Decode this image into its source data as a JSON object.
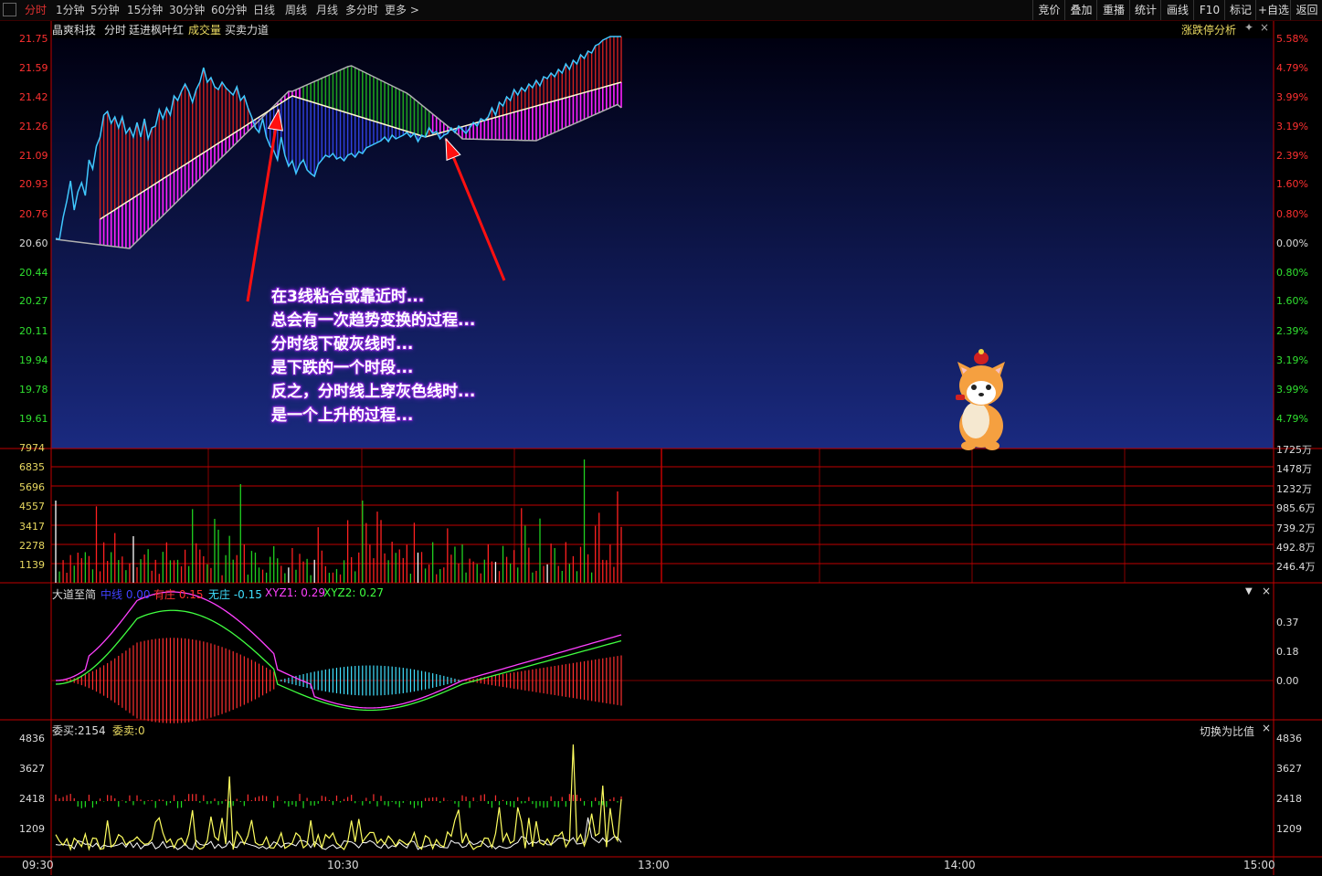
{
  "toolbar": {
    "periods": [
      "分时",
      "1分钟",
      "5分钟",
      "15分钟",
      "30分钟",
      "60分钟",
      "日线",
      "周线",
      "月线",
      "多分时",
      "更多 >"
    ],
    "active_period": "分时",
    "right_buttons": [
      "竞价",
      "叠加",
      "重播",
      "统计",
      "画线",
      "F10",
      "标记",
      "+自选",
      "返回"
    ]
  },
  "main_header": {
    "stock_name": "晶爽科技",
    "view": "分时",
    "indicator": "廷进枫叶红",
    "vol_label": "成交量",
    "force_label": "买卖力道",
    "right_label": "涨跌停分析"
  },
  "price_axis": {
    "left": [
      "21.75",
      "21.59",
      "21.42",
      "21.26",
      "21.09",
      "20.93",
      "20.76",
      "20.60",
      "20.44",
      "20.27",
      "20.11",
      "19.94",
      "19.78",
      "19.61"
    ],
    "right": [
      "5.58%",
      "4.79%",
      "3.99%",
      "3.19%",
      "2.39%",
      "1.60%",
      "0.80%",
      "0.00%",
      "0.80%",
      "1.60%",
      "2.39%",
      "3.19%",
      "3.99%",
      "4.79%"
    ]
  },
  "volume_axis": {
    "left": [
      "7974",
      "6835",
      "5696",
      "4557",
      "3417",
      "2278",
      "1139"
    ],
    "right": [
      "1725万",
      "1478万",
      "1232万",
      "985.6万",
      "739.2万",
      "492.8万",
      "246.4万"
    ]
  },
  "indicator_panel": {
    "name": "大道至简",
    "items": [
      {
        "label": "中线",
        "value": "0.00",
        "color": "#4040ff"
      },
      {
        "label": "有庄",
        "value": "0.15",
        "color": "#ff3030"
      },
      {
        "label": "无庄",
        "value": "-0.15",
        "color": "#40e0ff"
      },
      {
        "label": "XYZ1",
        "value": "0.29",
        "color": "#ff40ff"
      },
      {
        "label": "XYZ2",
        "value": "0.27",
        "color": "#40ff40"
      }
    ],
    "axis": [
      "0.37",
      "0.18",
      "0.00"
    ]
  },
  "order_panel": {
    "buy_label": "委买:2154",
    "sell_label": "委卖:0",
    "switch_label": "切换为比值",
    "axis": [
      "4836",
      "3627",
      "2418",
      "1209"
    ]
  },
  "time_axis": [
    "09:30",
    "10:30",
    "13:00",
    "14:00",
    "15:00"
  ],
  "annotation_lines": [
    "在3线粘合或靠近时...",
    "总会有一次趋势变换的过程...",
    "分时线下破灰线时...",
    "是下跌的一个时段...",
    "反之，分时线上穿灰色线时...",
    "是一个上升的过程..."
  ],
  "colors": {
    "up": "#ff2020",
    "down": "#20e020",
    "price_line": "#40c8ff",
    "avg_line": "#fffacd",
    "grey_line": "#b0b0b0",
    "magenta_fill": "#ff20ff",
    "green_fill": "#1ea01e",
    "panel_bg_top": "#000010",
    "panel_bg_bottom": "#1a2a80"
  },
  "mascot": "shiba-dog-mascot"
}
